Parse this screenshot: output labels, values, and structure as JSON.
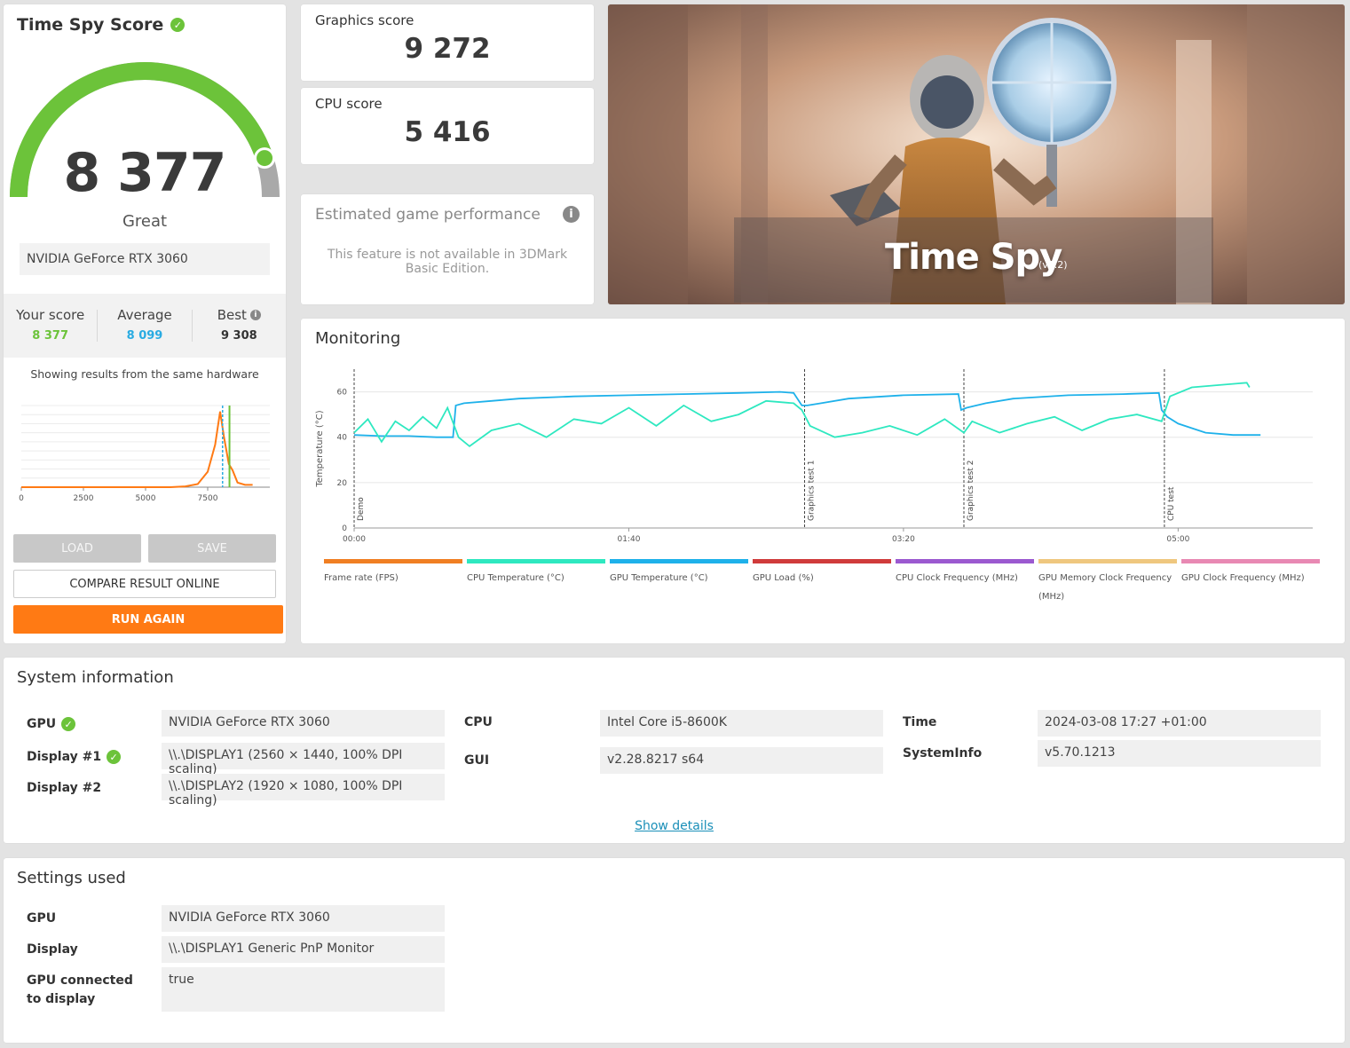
{
  "score_panel": {
    "title": "Time Spy Score",
    "score": "8 377",
    "rating": "Great",
    "gpu": "NVIDIA GeForce RTX 3060",
    "gauge_fraction": 0.9,
    "comparison": {
      "your_score_label": "Your score",
      "your_score": "8 377",
      "average_label": "Average",
      "average": "8 099",
      "best_label": "Best",
      "best": "9 308"
    },
    "same_hardware_text": "Showing results from the same hardware",
    "distribution_ticks": [
      "0",
      "2500",
      "5000",
      "7500"
    ],
    "buttons": {
      "load": "LOAD",
      "save": "SAVE",
      "compare": "COMPARE RESULT ONLINE",
      "run_again": "RUN AGAIN"
    },
    "colors": {
      "green": "#6cc33a",
      "blue": "#29abe2",
      "orange": "#ff7a14"
    }
  },
  "graphics_score": {
    "label": "Graphics score",
    "value": "9 272"
  },
  "cpu_score": {
    "label": "CPU score",
    "value": "5 416"
  },
  "estimated": {
    "title": "Estimated game performance",
    "message": "This feature is not available in 3DMark Basic Edition."
  },
  "hero": {
    "title": "Time Spy",
    "version": "(v1.2)"
  },
  "monitoring": {
    "title": "Monitoring",
    "legend": [
      {
        "label": "Frame rate (FPS)",
        "color": "#f07f23"
      },
      {
        "label": "CPU Temperature (°C)",
        "color": "#2ee8c0"
      },
      {
        "label": "GPU Temperature (°C)",
        "color": "#1eb1ea"
      },
      {
        "label": "GPU Load (%)",
        "color": "#d03b3b"
      },
      {
        "label": "CPU Clock Frequency (MHz)",
        "color": "#9b59d0"
      },
      {
        "label": "GPU Memory Clock Frequency (MHz)",
        "color": "#efc77f"
      },
      {
        "label": "GPU Clock Frequency (MHz)",
        "color": "#e889b3"
      }
    ]
  },
  "chart_data": {
    "type": "line",
    "title": "",
    "xlabel": "",
    "ylabel": "Temperature (°C)",
    "ylim": [
      0,
      70
    ],
    "y_ticks": [
      0,
      20,
      40,
      60
    ],
    "x_tick_labels": [
      "00:00",
      "01:40",
      "03:20",
      "05:00"
    ],
    "x_tick_seconds": [
      0,
      100,
      200,
      300
    ],
    "xlim_seconds": [
      0,
      349
    ],
    "markers": [
      {
        "label": "Demo",
        "x": 0
      },
      {
        "label": "Graphics test 1",
        "x": 164
      },
      {
        "label": "Graphics test 2",
        "x": 222
      },
      {
        "label": "CPU test",
        "x": 295
      }
    ],
    "series": [
      {
        "name": "GPU Temperature (°C)",
        "color": "#1eb1ea",
        "x": [
          0,
          10,
          20,
          30,
          36,
          37,
          40,
          50,
          60,
          80,
          100,
          120,
          140,
          155,
          160,
          163,
          165,
          170,
          180,
          200,
          220,
          221,
          223,
          230,
          240,
          260,
          280,
          293,
          294,
          296,
          300,
          305,
          310,
          320,
          330,
          327
        ],
        "y": [
          41,
          40.5,
          40.5,
          40,
          40,
          54,
          55,
          56,
          57,
          58,
          58.5,
          59,
          59.5,
          60,
          59.5,
          54,
          54,
          55,
          57,
          58.5,
          59,
          52,
          53,
          55,
          57,
          58.5,
          59,
          59.5,
          52,
          49,
          46,
          44,
          42,
          41,
          41,
          41
        ]
      },
      {
        "name": "CPU Temperature (°C)",
        "color": "#2ee8c0",
        "x": [
          0,
          5,
          10,
          15,
          20,
          25,
          30,
          34,
          38,
          42,
          50,
          60,
          70,
          80,
          90,
          100,
          110,
          120,
          130,
          140,
          150,
          160,
          163,
          166,
          175,
          185,
          195,
          205,
          215,
          222,
          225,
          235,
          245,
          255,
          265,
          275,
          285,
          294,
          297,
          305,
          315,
          325,
          326
        ],
        "y": [
          42,
          48,
          38,
          47,
          43,
          49,
          44,
          53,
          40,
          36,
          43,
          46,
          40,
          48,
          46,
          53,
          45,
          54,
          47,
          50,
          56,
          55,
          52,
          45,
          40,
          42,
          45,
          41,
          48,
          42,
          47,
          42,
          46,
          49,
          43,
          48,
          50,
          47,
          58,
          62,
          63,
          64,
          62
        ]
      }
    ]
  },
  "system_info": {
    "title": "System information",
    "gpu_label": "GPU",
    "gpu": "NVIDIA GeForce RTX 3060",
    "display1_label": "Display #1",
    "display1": "\\\\.\\DISPLAY1 (2560 × 1440, 100% DPI scaling)",
    "display2_label": "Display #2",
    "display2": "\\\\.\\DISPLAY2 (1920 × 1080, 100% DPI scaling)",
    "cpu_label": "CPU",
    "cpu": "Intel Core i5-8600K",
    "gui_label": "GUI",
    "gui": "v2.28.8217 s64",
    "time_label": "Time",
    "time": "2024-03-08 17:27 +01:00",
    "systeminfo_label": "SystemInfo",
    "systeminfo": "v5.70.1213",
    "show_details": "Show details"
  },
  "settings": {
    "title": "Settings used",
    "gpu_label": "GPU",
    "gpu": "NVIDIA GeForce RTX 3060",
    "display_label": "Display",
    "display": "\\\\.\\DISPLAY1 Generic PnP Monitor",
    "connected_label": "GPU connected to display",
    "connected": "true"
  }
}
